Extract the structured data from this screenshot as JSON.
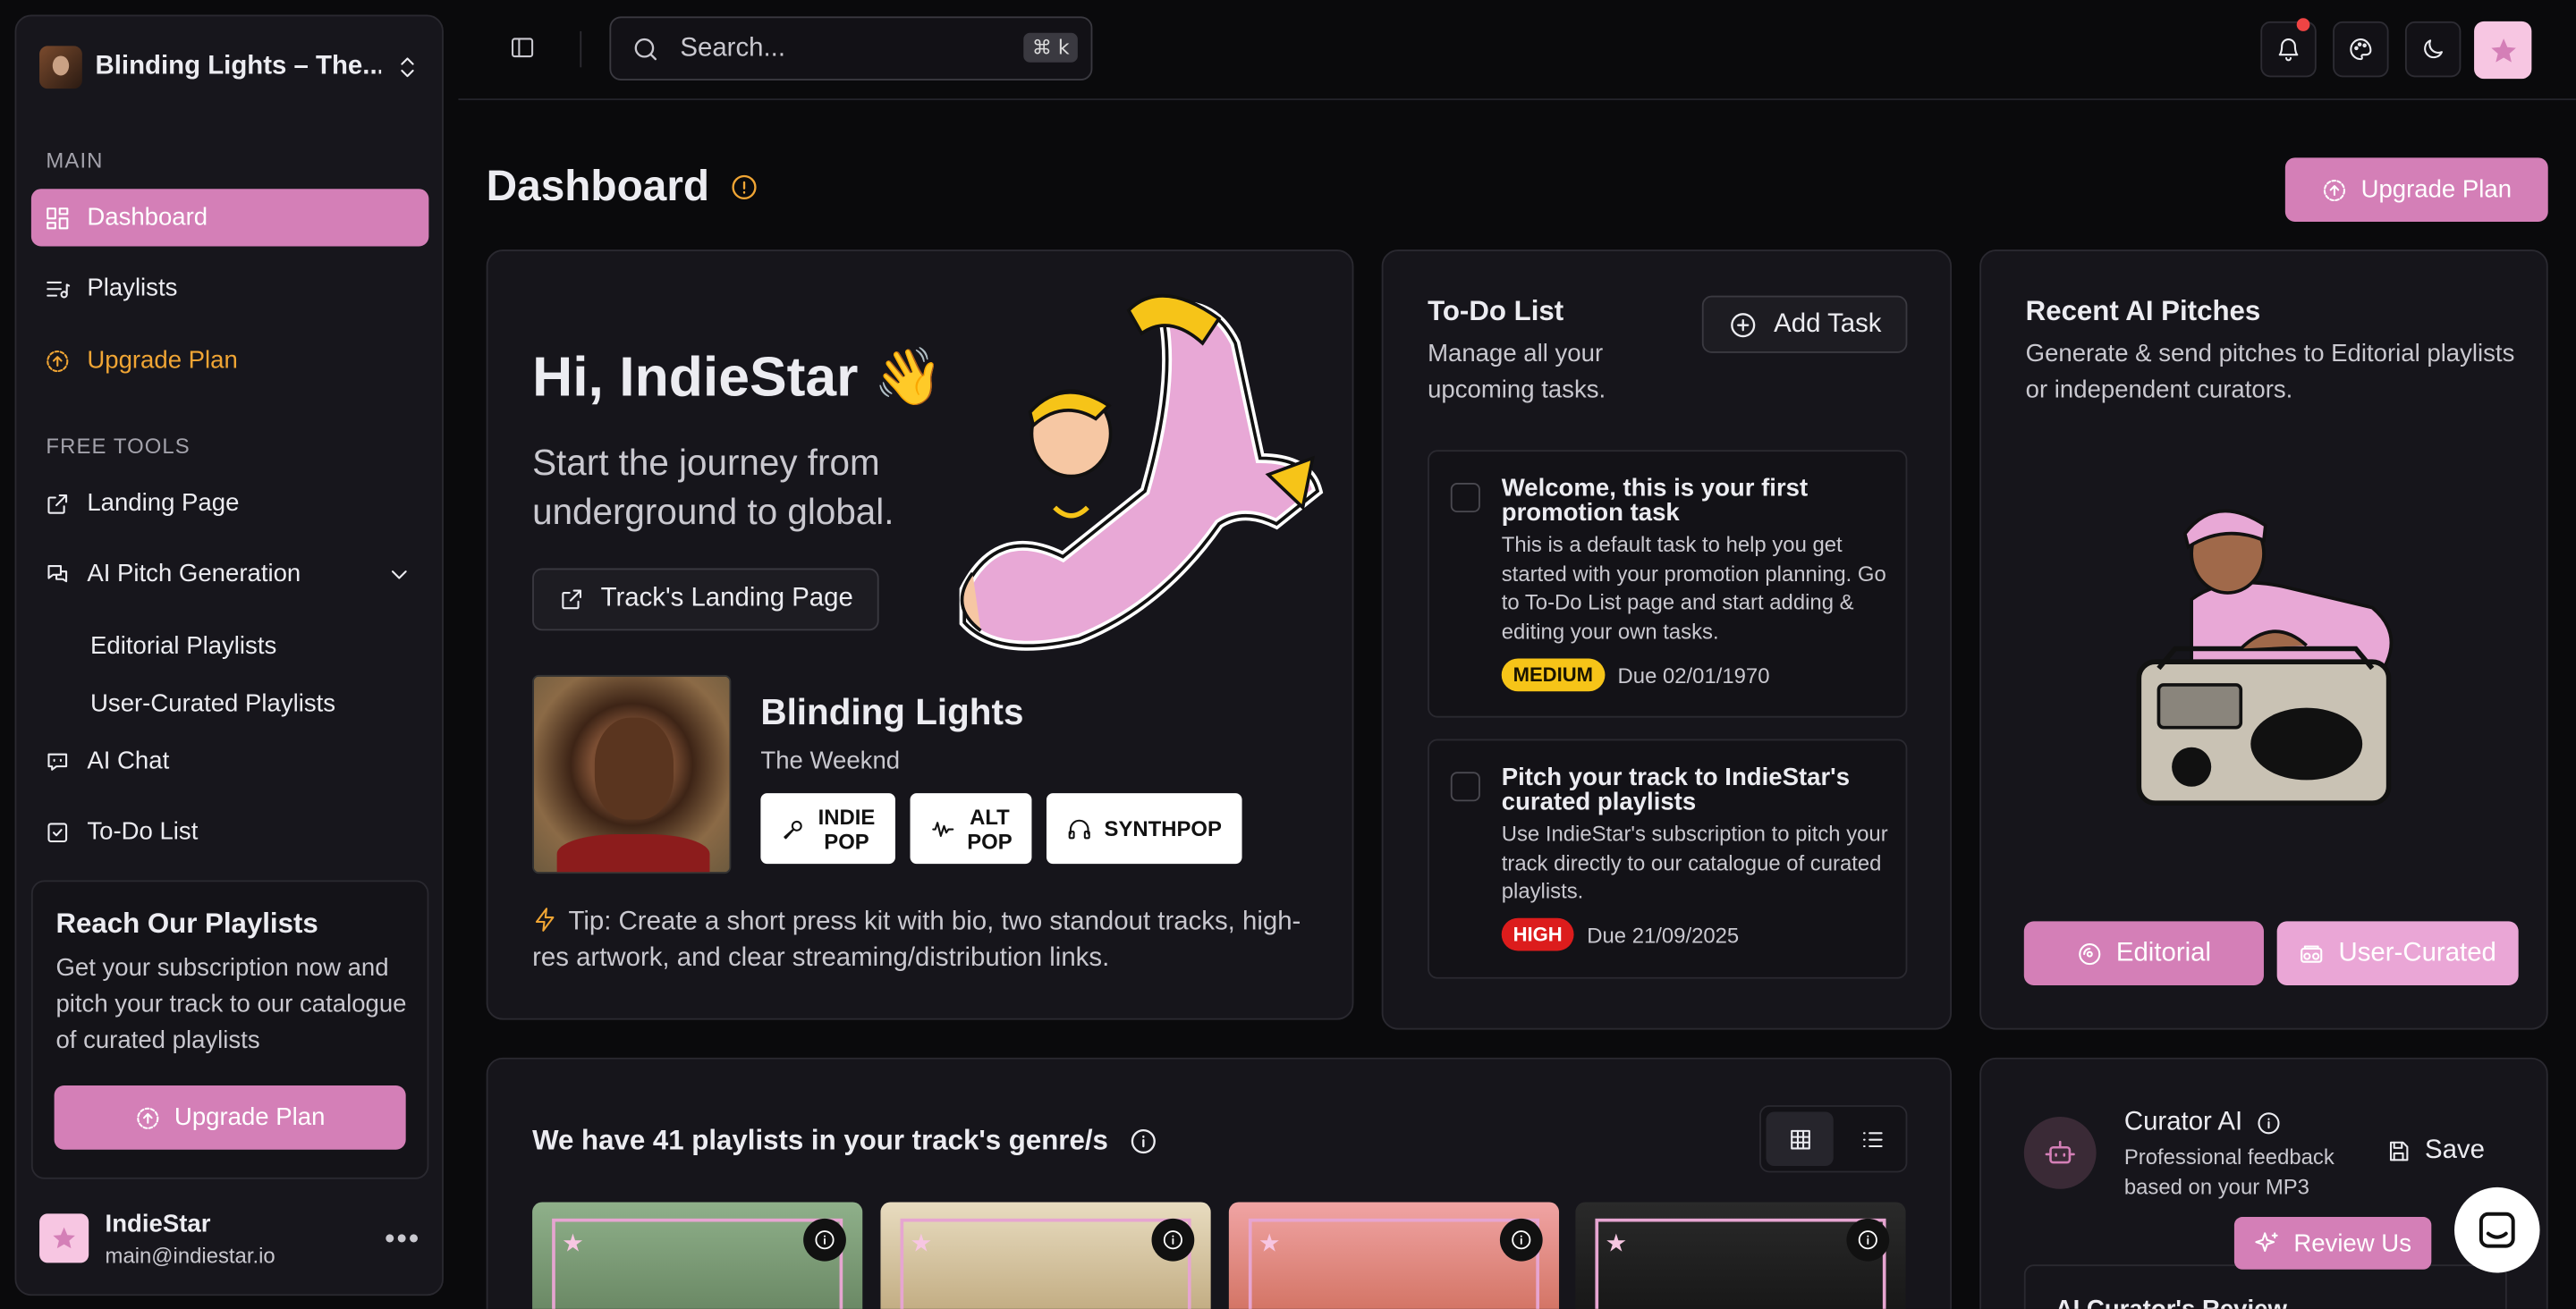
{
  "app": {
    "track_selector": "Blinding Lights – The...",
    "search_placeholder": "Search...",
    "search_shortcut": "⌘ k"
  },
  "sidebar": {
    "main_label": "MAIN",
    "free_tools_label": "FREE TOOLS",
    "items": {
      "dashboard": "Dashboard",
      "playlists": "Playlists",
      "upgrade": "Upgrade Plan",
      "landing": "Landing Page",
      "pitch": "AI Pitch Generation",
      "editorial": "Editorial Playlists",
      "user_curated": "User-Curated Playlists",
      "chat": "AI Chat",
      "todo": "To-Do List"
    },
    "promo": {
      "title": "Reach Our Playlists",
      "text": "Get your subscription now and pitch your track to our catalogue of curated playlists",
      "button": "Upgrade Plan"
    },
    "user": {
      "name": "IndieStar",
      "email": "main@indiestar.io"
    }
  },
  "page": {
    "title": "Dashboard",
    "upgrade_button": "Upgrade Plan"
  },
  "hero": {
    "greeting": "Hi, IndieStar 👋",
    "lead": "Start the journey from underground to global.",
    "landing_button": "Track's Landing Page",
    "track": {
      "title": "Blinding Lights",
      "artist": "The Weeknd"
    },
    "tags": [
      {
        "label": "INDIE\nPOP"
      },
      {
        "label": "ALT\nPOP"
      },
      {
        "label": "SYNTHPOP"
      }
    ],
    "tip": "Tip: Create a short press kit with bio, two standout tracks, high-res artwork, and clear streaming/distribution links."
  },
  "todo": {
    "title": "To-Do List",
    "subtitle": "Manage all your upcoming tasks.",
    "add_button": "Add Task",
    "tasks": [
      {
        "title": "Welcome, this is your first promotion task",
        "desc": "This is a default task to help you get started with your promotion planning. Go to To-Do List page and start adding & editing your own tasks.",
        "priority": "MEDIUM",
        "due": "Due 02/01/1970"
      },
      {
        "title": "Pitch your track to IndieStar's curated playlists",
        "desc": "Use IndieStar's subscription to pitch your track directly to our catalogue of curated playlists.",
        "priority": "HIGH",
        "due": "Due 21/09/2025"
      }
    ]
  },
  "pitches": {
    "title": "Recent AI Pitches",
    "subtitle": "Generate & send pitches to Editorial playlists or independent curators.",
    "editorial_button": "Editorial",
    "user_curated_button": "User-Curated"
  },
  "playlists": {
    "title": "We have 41 playlists in your track's genre/s"
  },
  "curator": {
    "name": "Curator AI",
    "subtitle": "Professional feedback based on your MP3",
    "save": "Save",
    "review_title": "AI Curator's Review"
  },
  "review_button": "Review Us",
  "colors": {
    "accent": "#d47fb7",
    "warning": "#f0a534",
    "medium": "#f6c418",
    "high": "#dc1c1c"
  }
}
